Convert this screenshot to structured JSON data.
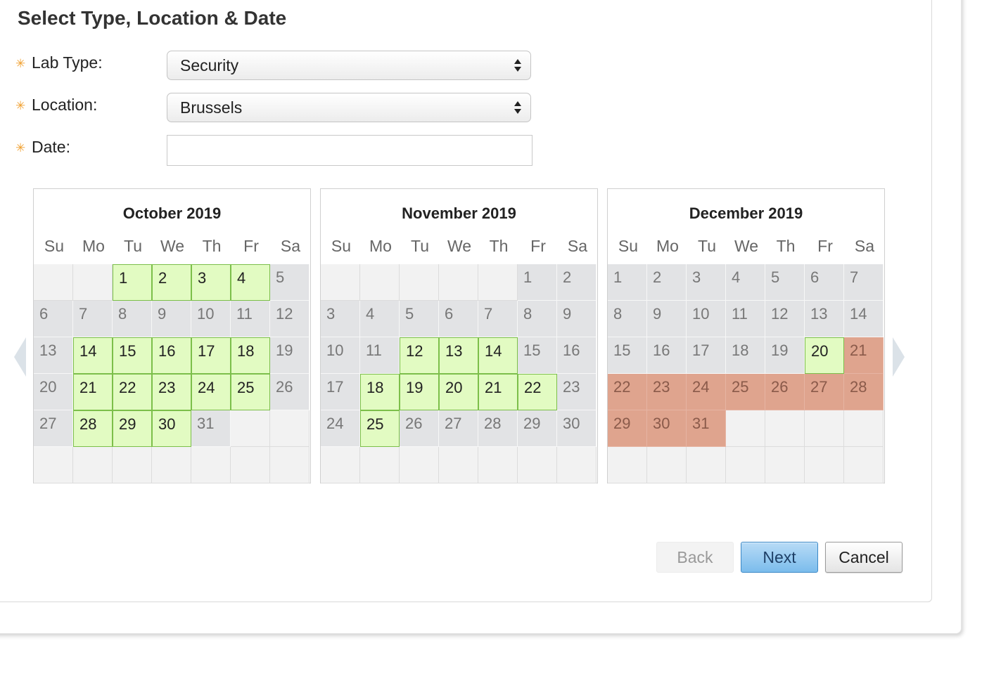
{
  "form": {
    "title": "Select Type, Location & Date",
    "lab_type": {
      "label": "Lab Type:",
      "value": "Security"
    },
    "location": {
      "label": "Location:",
      "value": "Brussels"
    },
    "date": {
      "label": "Date:",
      "value": ""
    }
  },
  "calendars": [
    {
      "title": "October 2019",
      "days_of_week": [
        "Su",
        "Mo",
        "Tu",
        "We",
        "Th",
        "Fr",
        "Sa"
      ],
      "weeks": [
        [
          null,
          null,
          {
            "d": "1",
            "s": "avail"
          },
          {
            "d": "2",
            "s": "avail"
          },
          {
            "d": "3",
            "s": "avail"
          },
          {
            "d": "4",
            "s": "avail"
          },
          {
            "d": "5",
            "s": "unavail"
          }
        ],
        [
          {
            "d": "6",
            "s": "unavail"
          },
          {
            "d": "7",
            "s": "unavail"
          },
          {
            "d": "8",
            "s": "unavail"
          },
          {
            "d": "9",
            "s": "unavail"
          },
          {
            "d": "10",
            "s": "unavail"
          },
          {
            "d": "11",
            "s": "unavail"
          },
          {
            "d": "12",
            "s": "unavail"
          }
        ],
        [
          {
            "d": "13",
            "s": "unavail"
          },
          {
            "d": "14",
            "s": "avail"
          },
          {
            "d": "15",
            "s": "avail"
          },
          {
            "d": "16",
            "s": "avail"
          },
          {
            "d": "17",
            "s": "avail"
          },
          {
            "d": "18",
            "s": "avail"
          },
          {
            "d": "19",
            "s": "unavail"
          }
        ],
        [
          {
            "d": "20",
            "s": "unavail"
          },
          {
            "d": "21",
            "s": "avail"
          },
          {
            "d": "22",
            "s": "avail"
          },
          {
            "d": "23",
            "s": "avail"
          },
          {
            "d": "24",
            "s": "avail"
          },
          {
            "d": "25",
            "s": "avail"
          },
          {
            "d": "26",
            "s": "unavail"
          }
        ],
        [
          {
            "d": "27",
            "s": "unavail"
          },
          {
            "d": "28",
            "s": "avail"
          },
          {
            "d": "29",
            "s": "avail"
          },
          {
            "d": "30",
            "s": "avail"
          },
          {
            "d": "31",
            "s": "unavail"
          },
          null,
          null
        ],
        [
          null,
          null,
          null,
          null,
          null,
          null,
          null
        ]
      ]
    },
    {
      "title": "November 2019",
      "days_of_week": [
        "Su",
        "Mo",
        "Tu",
        "We",
        "Th",
        "Fr",
        "Sa"
      ],
      "weeks": [
        [
          null,
          null,
          null,
          null,
          null,
          {
            "d": "1",
            "s": "unavail"
          },
          {
            "d": "2",
            "s": "unavail"
          }
        ],
        [
          {
            "d": "3",
            "s": "unavail"
          },
          {
            "d": "4",
            "s": "unavail"
          },
          {
            "d": "5",
            "s": "unavail"
          },
          {
            "d": "6",
            "s": "unavail"
          },
          {
            "d": "7",
            "s": "unavail"
          },
          {
            "d": "8",
            "s": "unavail"
          },
          {
            "d": "9",
            "s": "unavail"
          }
        ],
        [
          {
            "d": "10",
            "s": "unavail"
          },
          {
            "d": "11",
            "s": "unavail"
          },
          {
            "d": "12",
            "s": "avail"
          },
          {
            "d": "13",
            "s": "avail"
          },
          {
            "d": "14",
            "s": "avail"
          },
          {
            "d": "15",
            "s": "unavail"
          },
          {
            "d": "16",
            "s": "unavail"
          }
        ],
        [
          {
            "d": "17",
            "s": "unavail"
          },
          {
            "d": "18",
            "s": "avail"
          },
          {
            "d": "19",
            "s": "avail"
          },
          {
            "d": "20",
            "s": "avail"
          },
          {
            "d": "21",
            "s": "avail"
          },
          {
            "d": "22",
            "s": "avail"
          },
          {
            "d": "23",
            "s": "unavail"
          }
        ],
        [
          {
            "d": "24",
            "s": "unavail"
          },
          {
            "d": "25",
            "s": "avail"
          },
          {
            "d": "26",
            "s": "unavail"
          },
          {
            "d": "27",
            "s": "unavail"
          },
          {
            "d": "28",
            "s": "unavail"
          },
          {
            "d": "29",
            "s": "unavail"
          },
          {
            "d": "30",
            "s": "unavail"
          }
        ],
        [
          null,
          null,
          null,
          null,
          null,
          null,
          null
        ]
      ]
    },
    {
      "title": "December 2019",
      "days_of_week": [
        "Su",
        "Mo",
        "Tu",
        "We",
        "Th",
        "Fr",
        "Sa"
      ],
      "weeks": [
        [
          {
            "d": "1",
            "s": "unavail"
          },
          {
            "d": "2",
            "s": "unavail"
          },
          {
            "d": "3",
            "s": "unavail"
          },
          {
            "d": "4",
            "s": "unavail"
          },
          {
            "d": "5",
            "s": "unavail"
          },
          {
            "d": "6",
            "s": "unavail"
          },
          {
            "d": "7",
            "s": "unavail"
          }
        ],
        [
          {
            "d": "8",
            "s": "unavail"
          },
          {
            "d": "9",
            "s": "unavail"
          },
          {
            "d": "10",
            "s": "unavail"
          },
          {
            "d": "11",
            "s": "unavail"
          },
          {
            "d": "12",
            "s": "unavail"
          },
          {
            "d": "13",
            "s": "unavail"
          },
          {
            "d": "14",
            "s": "unavail"
          }
        ],
        [
          {
            "d": "15",
            "s": "unavail"
          },
          {
            "d": "16",
            "s": "unavail"
          },
          {
            "d": "17",
            "s": "unavail"
          },
          {
            "d": "18",
            "s": "unavail"
          },
          {
            "d": "19",
            "s": "unavail"
          },
          {
            "d": "20",
            "s": "avail"
          },
          {
            "d": "21",
            "s": "full"
          }
        ],
        [
          {
            "d": "22",
            "s": "full"
          },
          {
            "d": "23",
            "s": "full"
          },
          {
            "d": "24",
            "s": "full"
          },
          {
            "d": "25",
            "s": "full"
          },
          {
            "d": "26",
            "s": "full"
          },
          {
            "d": "27",
            "s": "full"
          },
          {
            "d": "28",
            "s": "full"
          }
        ],
        [
          {
            "d": "29",
            "s": "full"
          },
          {
            "d": "30",
            "s": "full"
          },
          {
            "d": "31",
            "s": "full"
          },
          null,
          null,
          null,
          null
        ],
        [
          null,
          null,
          null,
          null,
          null,
          null,
          null
        ]
      ]
    }
  ],
  "nav": {
    "prev_icon": "chevron-left-icon",
    "next_icon": "chevron-right-icon"
  },
  "buttons": {
    "back": "Back",
    "next": "Next",
    "cancel": "Cancel"
  },
  "colors": {
    "available": "#e2fbc2",
    "available_border": "#7cbf4a",
    "unavailable": "#e2e3e5",
    "fully_booked": "#dfa48e",
    "required_marker": "#f0a030",
    "next_button": "#7bbcec"
  }
}
